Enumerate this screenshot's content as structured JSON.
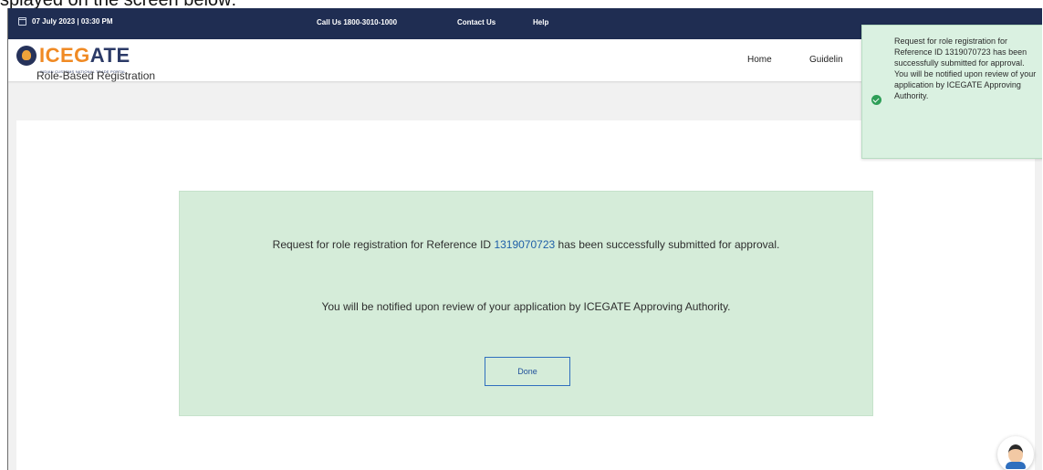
{
  "caption": "splayed on the screen below:",
  "topbar": {
    "datetime": "07 July 2023 | 03:30 PM",
    "call_us": "Call Us  1800-3010-1000",
    "contact_us": "Contact Us",
    "help": "Help"
  },
  "navbar": {
    "logo_text_orange": "ICEG",
    "logo_text_blue": "ATE",
    "logo_tagline": "INDIAN CUSTOMS NATIONAL TRADE PORTAL",
    "home": "Home",
    "guidelines": "Guidelin"
  },
  "page": {
    "title": "Role-Based Registration"
  },
  "panel": {
    "msg_prefix": "Request for role registration for Reference ID ",
    "reference_id": "1319070723",
    "msg_suffix": " has been successfully submitted for approval.",
    "msg_review": "You will be notified upon review of your application by ICEGATE Approving Authority.",
    "done_label": "Done"
  },
  "toast": {
    "text": "Request for role registration for Reference ID 1319070723 has been successfully submitted for approval. You will be notified upon review of your application by ICEGATE Approving Authority."
  },
  "colors": {
    "topbar_bg": "#1f2d52",
    "panel_bg": "#d5ecd9",
    "toast_bg": "#daf1e1",
    "success_icon": "#2e9e57",
    "link_blue": "#1f5fa8"
  },
  "icons": {
    "calendar": "calendar-icon",
    "success": "check-circle-icon",
    "chat": "chatbot-avatar-icon"
  }
}
